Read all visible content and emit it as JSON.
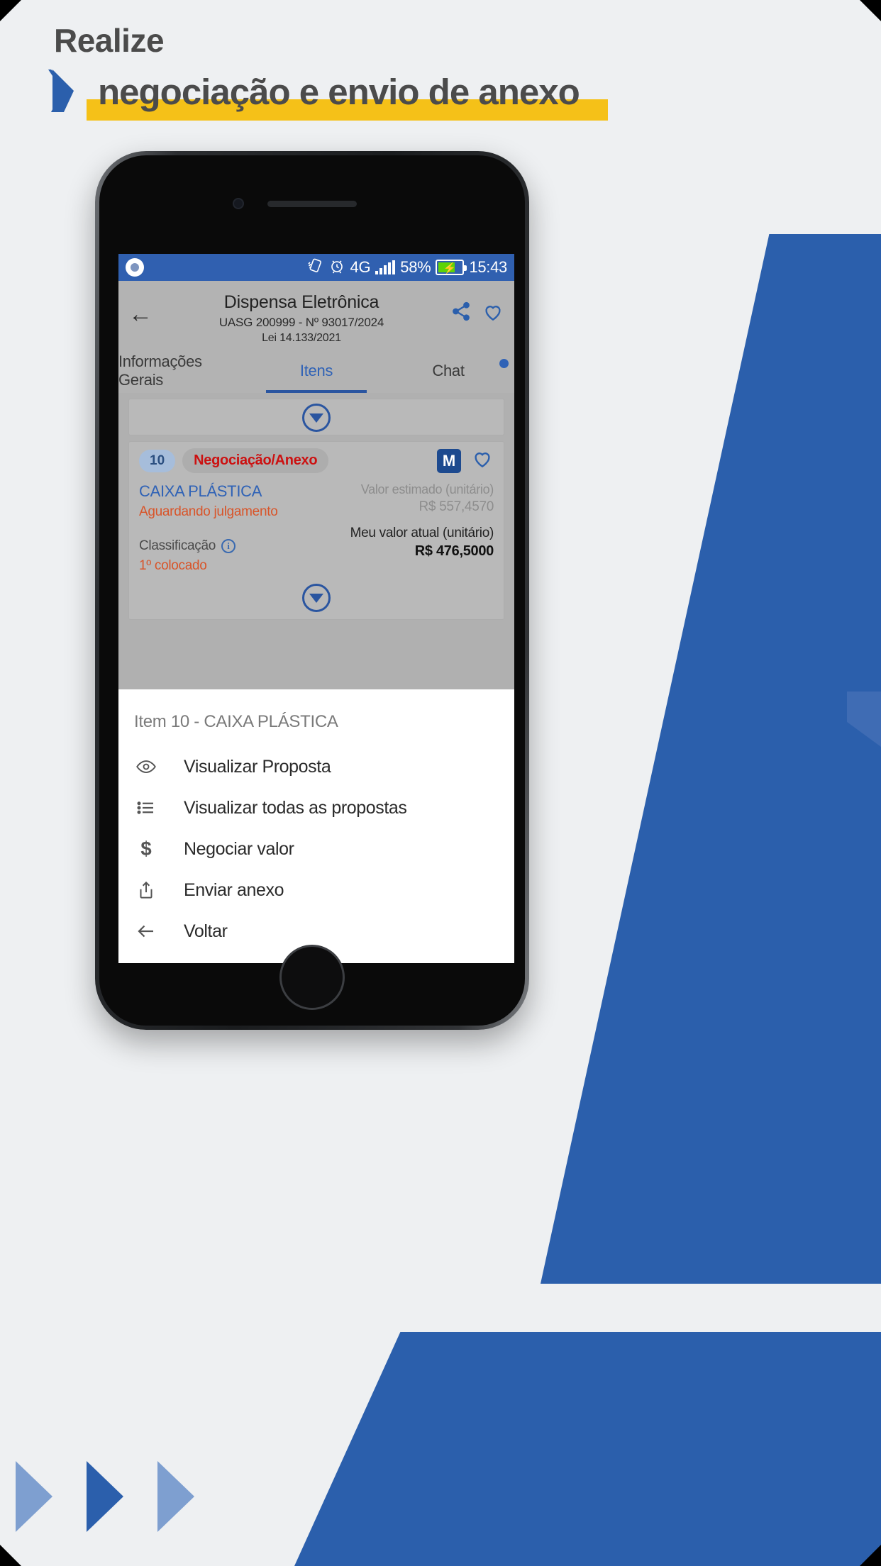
{
  "promo": {
    "kicker": "Realize",
    "headline": "negociação e envio de anexo",
    "accent_blue": "#2b5fac",
    "accent_yellow": "#f5c118",
    "chevron_icon": "chevron-right-icon",
    "arrow_icons": [
      "triangle-right-icon",
      "triangle-right-icon",
      "triangle-right-icon"
    ]
  },
  "statusbar": {
    "record_icon": "record-circle-icon",
    "rotation_icon": "screen-rotation-icon",
    "alarm_icon": "alarm-clock-icon",
    "network": "4G",
    "signal_icon": "signal-bars-icon",
    "battery_percent": "58%",
    "battery_icon": "battery-charging-icon",
    "time": "15:43",
    "background": "#3060b0"
  },
  "appbar": {
    "back_icon": "arrow-left-icon",
    "title": "Dispensa Eletrônica",
    "subtitle": "UASG 200999 - Nº 93017/2024",
    "subtitle2": "Lei 14.133/2021",
    "share_icon": "share-icon",
    "favorite_icon": "heart-outline-icon"
  },
  "tabs": [
    {
      "label": "Informações Gerais",
      "active": false,
      "has_dot": false
    },
    {
      "label": "Itens",
      "active": true,
      "has_dot": false
    },
    {
      "label": "Chat",
      "active": false,
      "has_dot": true
    }
  ],
  "card": {
    "number_badge": "10",
    "status_tag": "Negociação/Anexo",
    "m_badge": "M",
    "favorite_icon": "heart-outline-icon",
    "item_title": "CAIXA PLÁSTICA",
    "item_status": "Aguardando julgamento",
    "estimated_label": "Valor estimado (unitário)",
    "estimated_value": "R$ 557,4570",
    "my_value_label": "Meu valor atual (unitário)",
    "my_value": "R$ 476,5000",
    "classification_label": "Classificação",
    "classification_info_icon": "info-circle-icon",
    "classification_value": "1º colocado",
    "expand_icon": "chevron-down-circle-icon"
  },
  "sheet": {
    "title": "Item 10 - CAIXA PLÁSTICA",
    "items": [
      {
        "icon": "eye-icon",
        "label": "Visualizar Proposta"
      },
      {
        "icon": "list-icon",
        "label": "Visualizar todas as propostas"
      },
      {
        "icon": "dollar-icon",
        "label": "Negociar valor"
      },
      {
        "icon": "upload-share-icon",
        "label": "Enviar anexo"
      },
      {
        "icon": "arrow-left-icon",
        "label": "Voltar"
      }
    ]
  }
}
